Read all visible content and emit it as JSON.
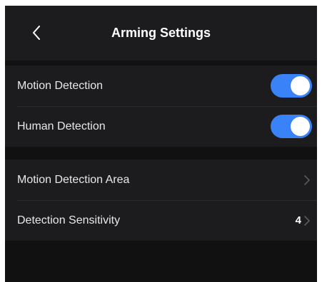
{
  "header": {
    "title": "Arming Settings",
    "back_icon": "chevron-left-icon"
  },
  "toggles": [
    {
      "label": "Motion Detection",
      "enabled": true
    },
    {
      "label": "Human Detection",
      "enabled": true
    }
  ],
  "settings": [
    {
      "label": "Motion Detection Area",
      "value": "",
      "icon": "chevron-right-icon"
    },
    {
      "label": "Detection Sensitivity",
      "value": "4",
      "icon": "chevron-right-icon"
    }
  ],
  "colors": {
    "accent": "#3a82f7",
    "background": "#111111",
    "surface": "#1c1c1e"
  }
}
